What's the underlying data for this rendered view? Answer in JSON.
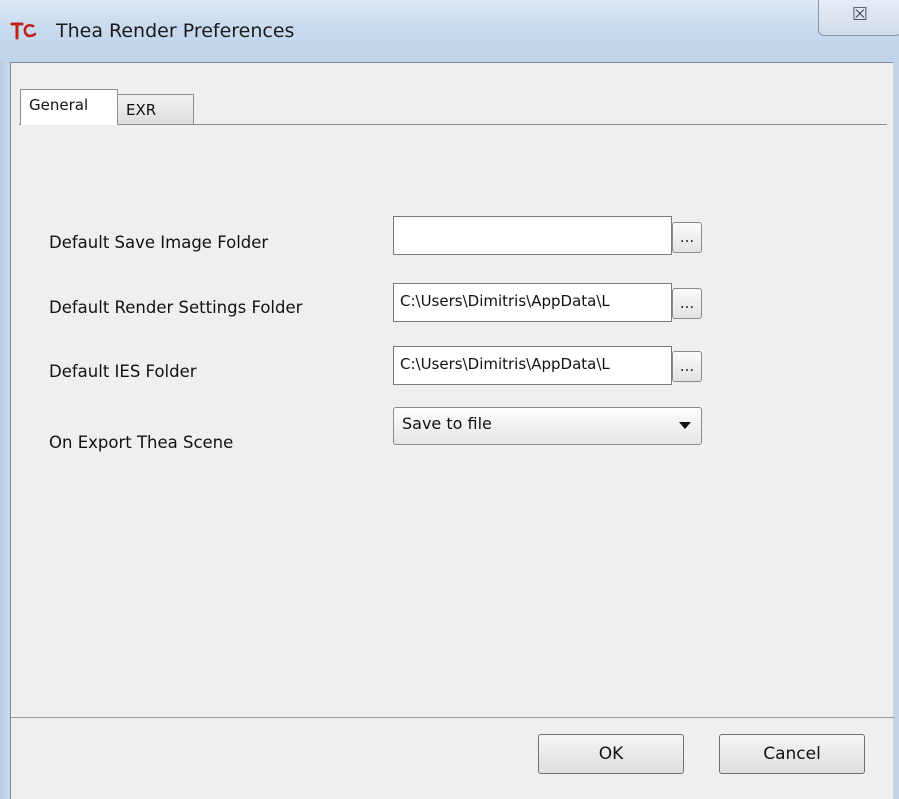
{
  "window": {
    "title": "Thea Render Preferences",
    "close_glyph": "☒",
    "icon": "thea-logo-icon",
    "accent_color": "#c0201a"
  },
  "tabs": [
    {
      "label": "General",
      "selected": true
    },
    {
      "label": "EXR",
      "selected": false
    }
  ],
  "general": {
    "fields": [
      {
        "label": "Default Save Image Folder",
        "value": "",
        "browse_label": "..."
      },
      {
        "label": "Default Render Settings Folder",
        "value": "C:\\Users\\Dimitris\\AppData\\L",
        "browse_label": "..."
      },
      {
        "label": "Default IES Folder",
        "value": "C:\\Users\\Dimitris\\AppData\\L",
        "browse_label": "..."
      }
    ],
    "export": {
      "label": "On Export Thea Scene",
      "selected": "Save to file"
    }
  },
  "buttons": {
    "ok": "OK",
    "cancel": "Cancel"
  }
}
